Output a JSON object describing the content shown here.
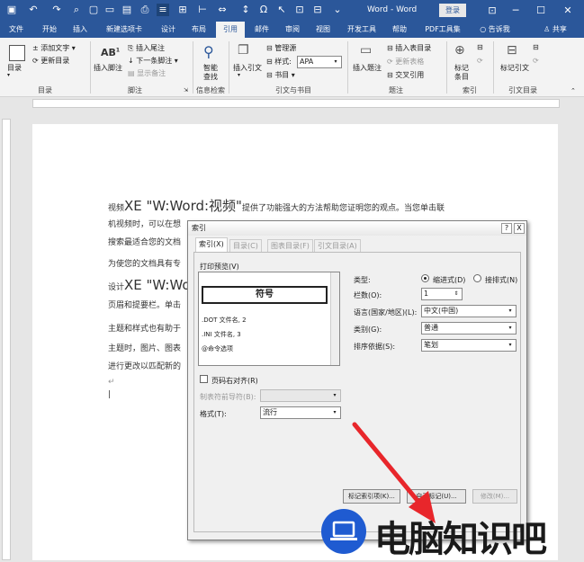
{
  "window": {
    "title": "Word - Word",
    "login_label": "登录"
  },
  "menu_tabs": [
    "文件",
    "开始",
    "插入",
    "新建选项卡",
    "设计",
    "布局",
    "引用",
    "邮件",
    "审阅",
    "视图",
    "开发工具",
    "帮助",
    "PDF工具集"
  ],
  "tell_me": "告诉我",
  "share": "共享",
  "ribbon": {
    "toc_label": "目录",
    "add_text": "添加文字",
    "update_toc": "更新目录",
    "group_toc": "目录",
    "insert_footnote_big": "插入脚注",
    "insert_endnote": "插入尾注",
    "next_footnote": "下一条脚注",
    "show_notes": "显示备注",
    "group_footnote": "脚注",
    "smart_lookup_line1": "智能",
    "smart_lookup_line2": "查找",
    "group_info": "信息检索",
    "insert_citation": "插入引文",
    "manage_sources": "管理源",
    "style_label": "样式:",
    "style_value": "APA",
    "bibliography": "书目",
    "group_citation": "引文与书目",
    "insert_caption": "插入题注",
    "insert_table_figures": "插入表目录",
    "update_table": "更新表格",
    "cross_ref": "交叉引用",
    "group_caption": "题注",
    "mark_entry_line1": "标记",
    "mark_entry_line2": "条目",
    "group_index": "索引",
    "mark_citation": "标记引文",
    "group_toa": "引文目录",
    "ab_icon": "AB"
  },
  "document": {
    "line1_pre": "视频",
    "xe1": "XE \"W:Word:视频\"",
    "line1_post": "提供了功能强大的方法帮助您证明您的观点。当您单击联",
    "line2": "机视频时，可以在想",
    "line3": "搜索最适合您的文档",
    "line4": "为使您的文档具有专",
    "line5_pre": "设计",
    "xe2": "XE \"W:Wo",
    "line6": "页眉和提要栏。单击",
    "line7": "主题和样式也有助于",
    "line8": "主题时，图片、图表",
    "line9": "进行更改以匹配新的"
  },
  "dialog": {
    "title": "索引",
    "help": "?",
    "close": "X",
    "tabs": [
      "索引(X)",
      "目录(C)",
      "图表目录(F)",
      "引文目录(A)"
    ],
    "print_preview_label": "打印预览(V)",
    "preview_symbol": "符号",
    "preview_items": [
      ".DOT 文件名, 2",
      ".INI 文件名, 3",
      "@命令选项"
    ],
    "type_label": "类型:",
    "type_indent": "缩进式(D)",
    "type_runin": "接排式(N)",
    "columns_label": "栏数(O):",
    "columns_value": "1",
    "language_label": "语言(国家/地区)(L):",
    "language_value": "中文(中国)",
    "category_label": "类别(G):",
    "category_value": "普通",
    "sort_label": "排序依据(S):",
    "sort_value": "笔划",
    "right_align_label": "页码右对齐(R)",
    "tab_leader_label": "制表符前导符(B):",
    "format_label": "格式(T):",
    "format_value": "流行",
    "mark_entry_btn": "标记索引项(K)...",
    "automark_btn": "自动标记(U)...",
    "modify_btn": "修改(M)..."
  },
  "watermark": {
    "text": "电脑知识吧"
  },
  "colors": {
    "word_blue": "#2b579a",
    "arrow_red": "#e8262b",
    "logo_blue": "#1f5bd1"
  }
}
